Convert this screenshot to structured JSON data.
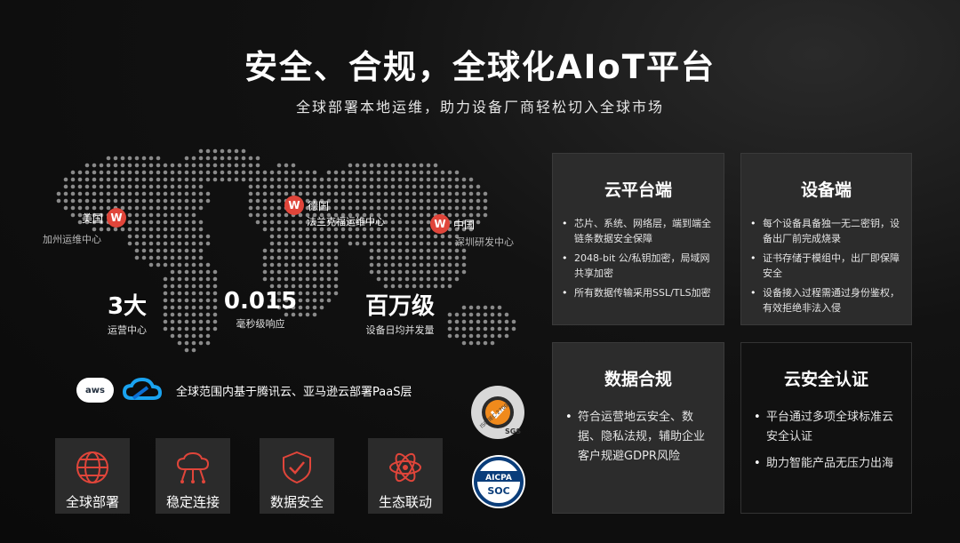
{
  "header": {
    "title": "安全、合规，全球化AIoT平台",
    "subtitle": "全球部署本地运维，助力设备厂商轻松切入全球市场"
  },
  "map": {
    "pins": [
      {
        "country": "美国",
        "center": "加州运维中心"
      },
      {
        "country": "德国",
        "center": "法兰克福运维中心"
      },
      {
        "country": "中国",
        "center": "深圳研发中心"
      }
    ]
  },
  "stats": [
    {
      "value": "3大",
      "label": "运营中心"
    },
    {
      "value": "0.015",
      "label": "毫秒级响应"
    },
    {
      "value": "百万级",
      "label": "设备日均并发量"
    }
  ],
  "cloud": {
    "aws_text": "aws",
    "text": "全球范围内基于腾讯云、亚马逊云部署PaaS层"
  },
  "features": [
    {
      "label": "全球部署",
      "icon": "globe-icon"
    },
    {
      "label": "稳定连接",
      "icon": "cloud-connection-icon"
    },
    {
      "label": "数据安全",
      "icon": "shield-check-icon"
    },
    {
      "label": "生态联动",
      "icon": "atom-icon"
    }
  ],
  "certs": {
    "iso_text": "ISO/IEC 27001",
    "sgs_text": "SGS",
    "aicpa_text": "AICPA",
    "soc_text": "SOC"
  },
  "cards": [
    {
      "title": "云平台端",
      "items": [
        "芯片、系统、网络层，端到端全链条数据安全保障",
        "2048-bit 公/私钥加密，局域网共享加密",
        "所有数据传输采用SSL/TLS加密"
      ]
    },
    {
      "title": "设备端",
      "items": [
        "每个设备具备独一无二密钥，设备出厂前完成烧录",
        "证书存储于模组中，出厂即保障安全",
        "设备接入过程需通过身份鉴权，有效拒绝非法入侵"
      ]
    },
    {
      "title": "数据合规",
      "items": [
        "符合运营地云安全、数据、隐私法规，辅助企业客户规避GDPR风险"
      ]
    },
    {
      "title": "云安全认证",
      "items": [
        "平台通过多项全球标准云安全认证",
        "助力智能产品无压力出海"
      ]
    }
  ],
  "colors": {
    "accent": "#e0453a",
    "card_bg": "#2c2c2c",
    "cloud_blue": "#1aa3f0"
  }
}
